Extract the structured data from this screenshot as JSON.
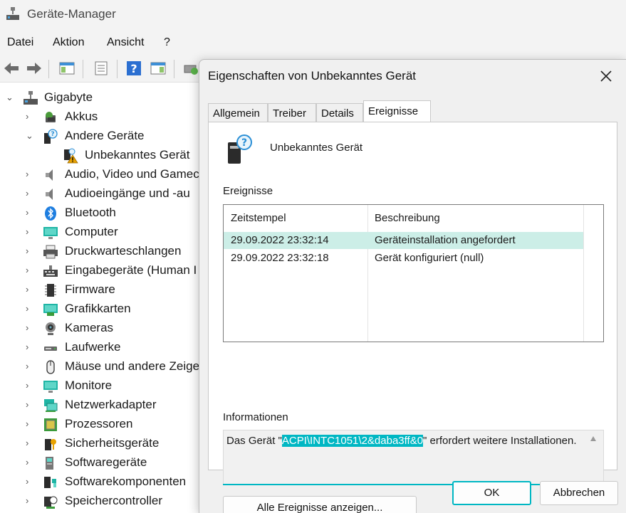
{
  "window": {
    "title": "Geräte-Manager"
  },
  "menu": [
    "Datei",
    "Aktion",
    "Ansicht",
    "?"
  ],
  "tree": {
    "root": "Gigabyte",
    "items": [
      {
        "label": "Akkus",
        "icon": "battery-icon",
        "expanded": false
      },
      {
        "label": "Andere Geräte",
        "icon": "unknown-device-icon",
        "expanded": true
      },
      {
        "label": "Unbekanntes Gerät",
        "icon": "warning-device-icon",
        "child": true
      },
      {
        "label": "Audio, Video und Gamec",
        "icon": "speaker-icon",
        "expanded": false
      },
      {
        "label": "Audioeingänge und -au",
        "icon": "speaker-icon",
        "expanded": false
      },
      {
        "label": "Bluetooth",
        "icon": "bluetooth-icon",
        "expanded": false
      },
      {
        "label": "Computer",
        "icon": "monitor-icon",
        "expanded": false
      },
      {
        "label": "Druckwarteschlangen",
        "icon": "printer-icon",
        "expanded": false
      },
      {
        "label": "Eingabegeräte (Human I",
        "icon": "keyboard-icon",
        "expanded": false
      },
      {
        "label": "Firmware",
        "icon": "chip-icon",
        "expanded": false
      },
      {
        "label": "Grafikkarten",
        "icon": "display-adapter-icon",
        "expanded": false
      },
      {
        "label": "Kameras",
        "icon": "camera-icon",
        "expanded": false
      },
      {
        "label": "Laufwerke",
        "icon": "drive-icon",
        "expanded": false
      },
      {
        "label": "Mäuse und andere Zeige",
        "icon": "mouse-icon",
        "expanded": false
      },
      {
        "label": "Monitore",
        "icon": "monitor-icon",
        "expanded": false
      },
      {
        "label": "Netzwerkadapter",
        "icon": "network-icon",
        "expanded": false
      },
      {
        "label": "Prozessoren",
        "icon": "processor-icon",
        "expanded": false
      },
      {
        "label": "Sicherheitsgeräte",
        "icon": "security-device-icon",
        "expanded": false
      },
      {
        "label": "Softwaregeräte",
        "icon": "software-device-icon",
        "expanded": false
      },
      {
        "label": "Softwarekomponenten",
        "icon": "software-component-icon",
        "expanded": false
      },
      {
        "label": "Speichercontroller",
        "icon": "storage-controller-icon",
        "expanded": false
      }
    ]
  },
  "dialog": {
    "title": "Eigenschaften von Unbekanntes Gerät",
    "tabs": [
      "Allgemein",
      "Treiber",
      "Details",
      "Ereignisse"
    ],
    "active_tab": "Ereignisse",
    "device_name": "Unbekanntes Gerät",
    "events_label": "Ereignisse",
    "columns": [
      "Zeitstempel",
      "Beschreibung"
    ],
    "events": [
      {
        "timestamp": "29.09.2022 23:32:14",
        "description": "Geräteinstallation angefordert",
        "selected": true
      },
      {
        "timestamp": "29.09.2022 23:32:18",
        "description": "Gerät konfiguriert (null)",
        "selected": false
      }
    ],
    "info_label": "Informationen",
    "info": {
      "prefix": "Das Gerät \"",
      "highlight": "ACPI\\INTC1051\\2&daba3ff&0",
      "suffix": "\" erfordert weitere Installationen."
    },
    "show_all_button": "Alle Ereignisse anzeigen...",
    "ok_button": "OK",
    "cancel_button": "Abbrechen"
  },
  "colors": {
    "accent": "#00b7c3",
    "selection": "#cceee7",
    "warning": "#e8a200"
  }
}
